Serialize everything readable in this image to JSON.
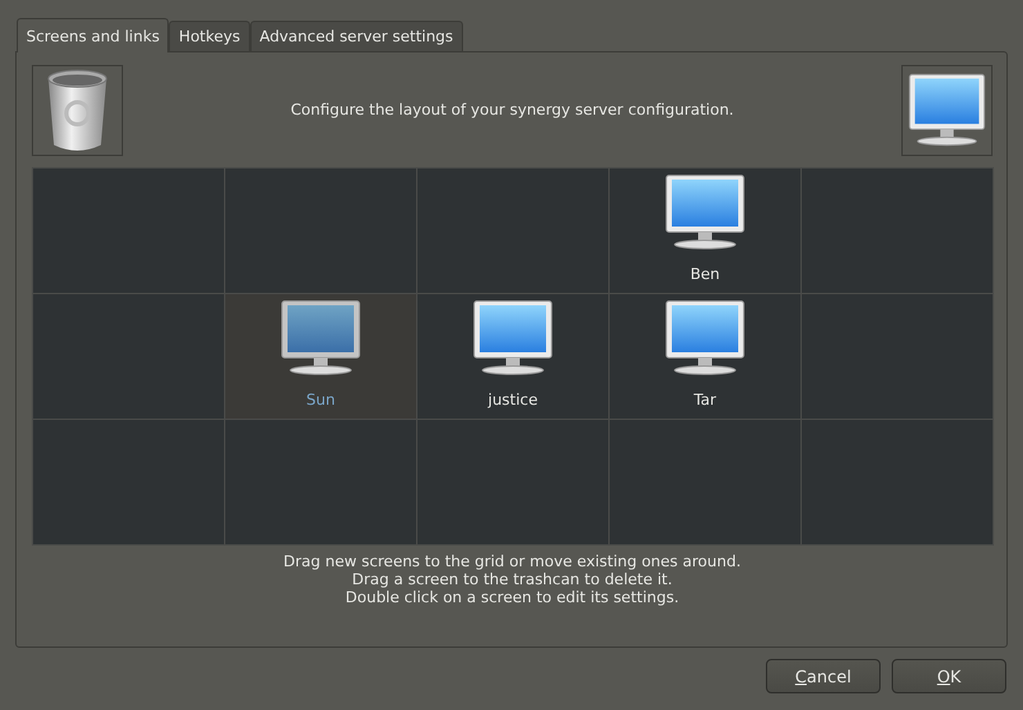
{
  "tabs": [
    {
      "label": "Screens and links",
      "selected": true
    },
    {
      "label": "Hotkeys",
      "selected": false
    },
    {
      "label": "Advanced server settings",
      "selected": false
    }
  ],
  "header": {
    "description": "Configure the layout of your synergy server configuration."
  },
  "grid": {
    "rows": [
      {
        "cells": [
          {
            "kind": "empty"
          },
          {
            "kind": "empty"
          },
          {
            "kind": "empty"
          },
          {
            "kind": "screen",
            "name": "Ben",
            "selected": false
          },
          {
            "kind": "empty"
          }
        ]
      },
      {
        "cells": [
          {
            "kind": "empty"
          },
          {
            "kind": "screen",
            "name": "Sun",
            "selected": true
          },
          {
            "kind": "screen",
            "name": "justice",
            "selected": false
          },
          {
            "kind": "screen",
            "name": "Tar",
            "selected": false
          },
          {
            "kind": "empty"
          }
        ]
      },
      {
        "cells": [
          {
            "kind": "empty"
          },
          {
            "kind": "empty"
          },
          {
            "kind": "empty"
          },
          {
            "kind": "empty"
          },
          {
            "kind": "empty"
          }
        ]
      }
    ]
  },
  "instructions": [
    "Drag new screens to the grid or move existing ones around.",
    "Drag a screen to the trashcan to delete it.",
    "Double click on a screen to edit its settings."
  ],
  "buttons": [
    "Cancel",
    "OK"
  ]
}
